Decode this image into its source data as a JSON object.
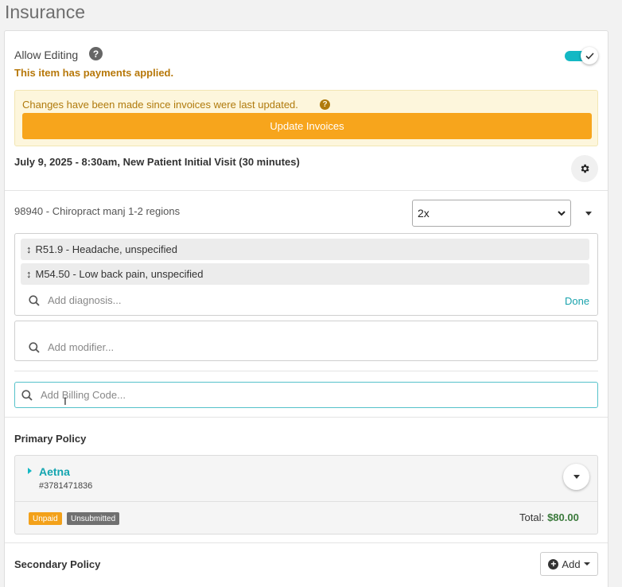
{
  "page": {
    "title": "Insurance"
  },
  "editing": {
    "label": "Allow Editing",
    "help_glyph": "?",
    "toggle_on": true,
    "payments_note": "This item has payments applied."
  },
  "alert": {
    "message": "Changes have been made since invoices were last updated.",
    "help_glyph": "?",
    "button_label": "Update Invoices"
  },
  "visit": {
    "title": "July 9, 2025 - 8:30am, New Patient Initial Visit (30 minutes)"
  },
  "procedure": {
    "code_label": "98940 - Chiropract manj 1-2 regions",
    "units_selected": "2x"
  },
  "diagnoses": {
    "items": [
      {
        "label": "R51.9 - Headache, unspecified"
      },
      {
        "label": "M54.50 - Low back pain, unspecified"
      }
    ],
    "search_placeholder": "Add diagnosis...",
    "done_label": "Done"
  },
  "modifier": {
    "search_placeholder": "Add modifier..."
  },
  "billing": {
    "search_placeholder": "Add Billing Code..."
  },
  "primary_policy": {
    "heading": "Primary Policy",
    "insurer": "Aetna",
    "policy_number": "#3781471836",
    "badges": [
      "Unpaid",
      "Unsubmitted"
    ],
    "total_label": "Total:",
    "total_value": "$80.00"
  },
  "secondary_policy": {
    "heading": "Secondary Policy",
    "add_label": "Add"
  },
  "colors": {
    "accent": "#14b8c4",
    "warning": "#f7a51c",
    "warning_text": "#b07a0c",
    "total_green": "#3b7a3c",
    "badge_unsubmitted": "#707070"
  }
}
